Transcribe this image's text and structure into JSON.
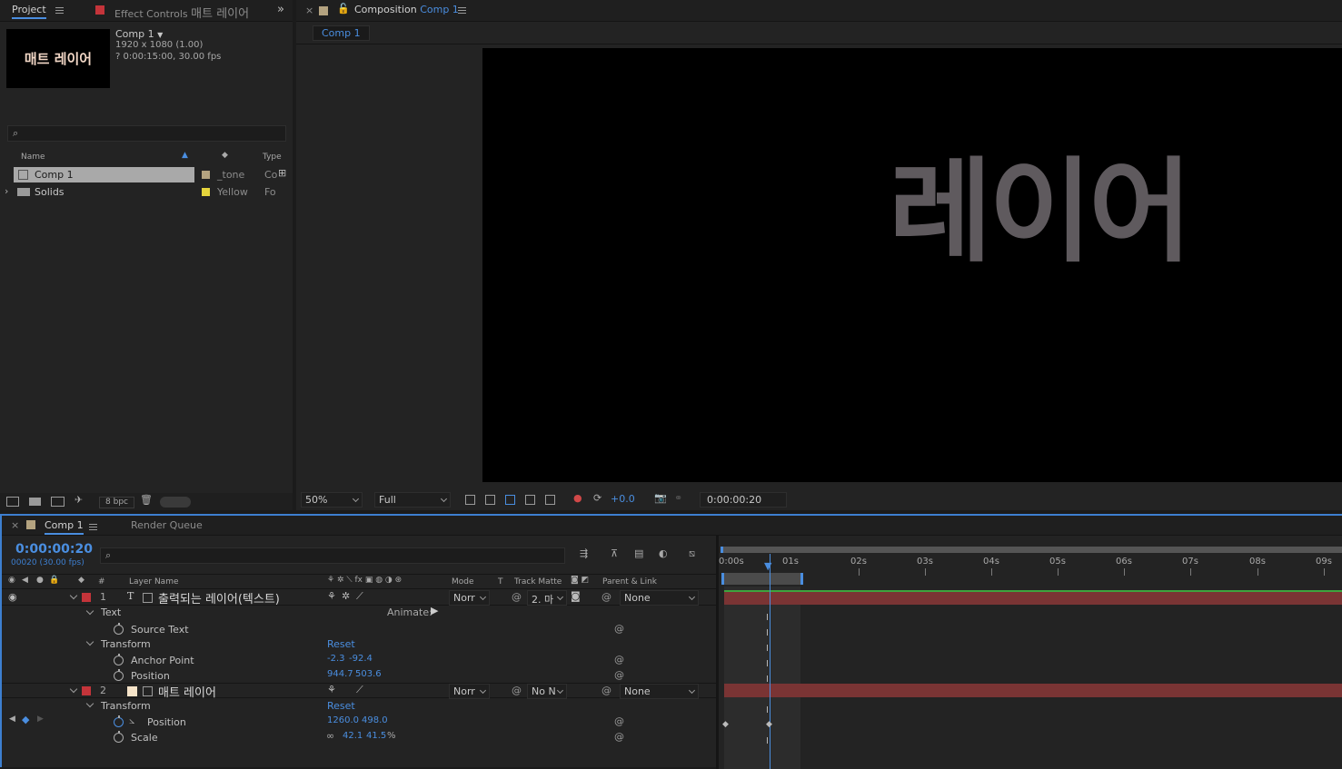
{
  "project": {
    "tab_label": "Project",
    "effect_controls_label": "Effect Controls",
    "effect_controls_target": "매트 레이어",
    "thumbnail_text": "매트 레이어",
    "comp_name": "Comp 1",
    "comp_size": "1920 x 1080 (1.00)",
    "comp_duration": "? 0:00:15:00, 30.00 fps",
    "search_placeholder": "",
    "columns": {
      "name": "Name",
      "type": "Type"
    },
    "items": [
      {
        "name": "Comp 1",
        "label": "_tone",
        "type": "Co",
        "color": "#b4a380"
      },
      {
        "name": "Solids",
        "label": "Yellow",
        "type": "Fo",
        "color": "#e5d43c"
      }
    ],
    "bpc": "8 bpc"
  },
  "composition": {
    "tab_prefix": "Composition",
    "tab_name": "Comp 1",
    "breadcrumb": "Comp 1",
    "canvas_text": "레이어",
    "zoom": "50%",
    "resolution": "Full",
    "exposure": "+0.0",
    "timecode": "0:00:00:20"
  },
  "timeline": {
    "comp_tab": "Comp 1",
    "render_queue": "Render Queue",
    "timecode": "0:00:00:20",
    "frame_info": "00020 (30.00 fps)",
    "columns": {
      "number": "#",
      "layer_name": "Layer Name",
      "mode": "Mode",
      "t": "T",
      "track_matte": "Track Matte",
      "parent": "Parent & Link"
    },
    "ruler": [
      "0:00s",
      "01s",
      "02s",
      "03s",
      "04s",
      "05s",
      "06s",
      "07s",
      "08s",
      "09s"
    ],
    "animate_label": "Animate:",
    "layers": [
      {
        "num": "1",
        "name": "출력되는 레이어(텍스트)",
        "mode": "Norr",
        "matte": "2. 마",
        "parent": "None",
        "color": "#c4343a"
      },
      {
        "num": "2",
        "name": "매트 레이어",
        "mode": "Norr",
        "matte": "No N",
        "parent": "None",
        "color": "#c4343a"
      }
    ],
    "props": {
      "text_group": "Text",
      "source_text": "Source Text",
      "transform": "Transform",
      "reset": "Reset",
      "anchor_point": "Anchor Point",
      "anchor_value_x": "-2.3",
      "anchor_value_y": "-92.4",
      "position": "Position",
      "position1_x": "944.7",
      "position1_y": "503.6",
      "position2_x": "1260.0",
      "position2_y": "498.0",
      "scale": "Scale",
      "scale_x": "42.1",
      "scale_y": "41.5",
      "scale_unit": "%"
    }
  },
  "colors": {
    "accent": "#4a8ee0",
    "layer_bar": "#7a3434",
    "text_gray": "#5f5a5e"
  }
}
